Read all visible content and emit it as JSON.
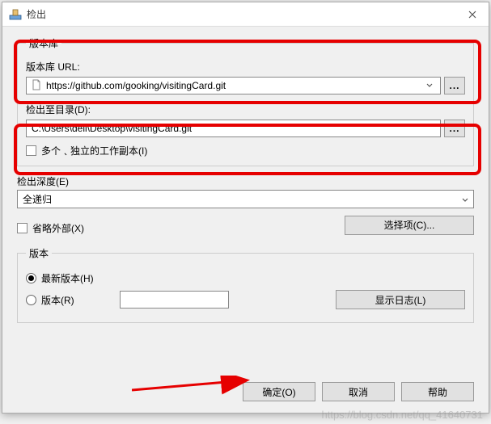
{
  "title": "检出",
  "repo": {
    "legend": "版本库",
    "url_label": "版本库 URL:",
    "url_value": "https://github.com/gooking/visitingCard.git",
    "dir_label": "检出至目录(D):",
    "dir_value": "C:\\Users\\dell\\Desktop\\visitingCard.git",
    "multi_label": "多个﹑独立的工作副本(I)"
  },
  "depth": {
    "label": "检出深度(E)",
    "selected": "全递归",
    "omit_externals": "省略外部(X)",
    "choose_btn": "选择项(C)..."
  },
  "rev": {
    "legend": "版本",
    "head_label": "最新版本(H)",
    "rev_label": "版本(R)",
    "log_btn": "显示日志(L)"
  },
  "footer": {
    "ok": "确定(O)",
    "cancel": "取消",
    "help": "帮助"
  },
  "watermark": "https://blog.csdn.net/qq_41640731"
}
